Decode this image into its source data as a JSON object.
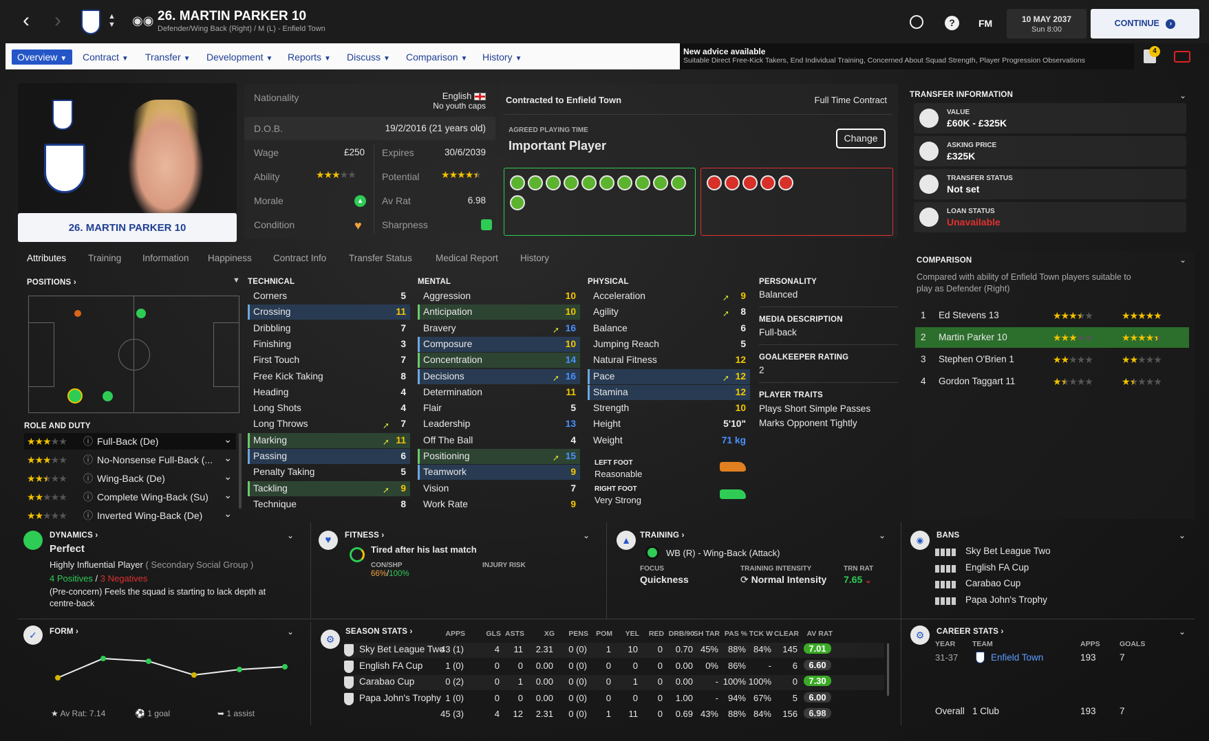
{
  "header": {
    "title": "26. MARTIN PARKER 10",
    "subtitle": "Defender/Wing Back (Right) / M (L) - Enfield Town",
    "date": "10 MAY 2037",
    "time": "Sun 8:00",
    "continue_label": "CONTINUE",
    "fm_label": "FM",
    "news_badge": "4"
  },
  "menu": [
    {
      "label": "Overview"
    },
    {
      "label": "Contract"
    },
    {
      "label": "Transfer"
    },
    {
      "label": "Development"
    },
    {
      "label": "Reports"
    },
    {
      "label": "Discuss"
    },
    {
      "label": "Comparison"
    },
    {
      "label": "History"
    }
  ],
  "advice": {
    "title": "New advice available",
    "text": "Suitable Direct Free-Kick Takers, End Individual Training, Concerned About Squad Strength, Player Progression Observations"
  },
  "player_card": {
    "name": "26. MARTIN PARKER 10"
  },
  "info": {
    "nationality_label": "Nationality",
    "nationality": "English",
    "youth_caps": "No youth caps",
    "dob_label": "D.O.B.",
    "dob": "19/2/2016 (21 years old)",
    "wage_label": "Wage",
    "wage": "£250",
    "expires_label": "Expires",
    "expires": "30/6/2039",
    "ability_label": "Ability",
    "potential_label": "Potential",
    "morale_label": "Morale",
    "avrat_label": "Av Rat",
    "avrat": "6.98",
    "condition_label": "Condition",
    "sharpness_label": "Sharpness"
  },
  "contract": {
    "title": "Contracted to Enfield Town",
    "type": "Full Time Contract",
    "playing_time_label": "AGREED PLAYING TIME",
    "playing_time": "Important Player",
    "change_label": "Change"
  },
  "tabs": [
    "Attributes",
    "Training",
    "Information",
    "Happiness",
    "Contract Info",
    "Transfer Status",
    "Medical Report",
    "History"
  ],
  "positions_label": "POSITIONS",
  "role_duty_label": "ROLE AND DUTY",
  "roles": [
    {
      "label": "Full-Back (De)",
      "stars": 3
    },
    {
      "label": "No-Nonsense Full-Back (...",
      "stars": 3
    },
    {
      "label": "Wing-Back (De)",
      "stars": 2.5
    },
    {
      "label": "Complete Wing-Back (Su)",
      "stars": 2
    },
    {
      "label": "Inverted Wing-Back (De)",
      "stars": 2
    }
  ],
  "technical": {
    "title": "TECHNICAL",
    "items": [
      {
        "name": "Corners",
        "value": "5"
      },
      {
        "name": "Crossing",
        "value": "11"
      },
      {
        "name": "Dribbling",
        "value": "7"
      },
      {
        "name": "Finishing",
        "value": "3"
      },
      {
        "name": "First Touch",
        "value": "7"
      },
      {
        "name": "Free Kick Taking",
        "value": "8"
      },
      {
        "name": "Heading",
        "value": "4"
      },
      {
        "name": "Long Shots",
        "value": "4"
      },
      {
        "name": "Long Throws",
        "value": "7"
      },
      {
        "name": "Marking",
        "value": "11"
      },
      {
        "name": "Passing",
        "value": "6"
      },
      {
        "name": "Penalty Taking",
        "value": "5"
      },
      {
        "name": "Tackling",
        "value": "9"
      },
      {
        "name": "Technique",
        "value": "8"
      }
    ]
  },
  "mental": {
    "title": "MENTAL",
    "items": [
      {
        "name": "Aggression",
        "value": "10"
      },
      {
        "name": "Anticipation",
        "value": "10"
      },
      {
        "name": "Bravery",
        "value": "16"
      },
      {
        "name": "Composure",
        "value": "10"
      },
      {
        "name": "Concentration",
        "value": "14"
      },
      {
        "name": "Decisions",
        "value": "16"
      },
      {
        "name": "Determination",
        "value": "11"
      },
      {
        "name": "Flair",
        "value": "5"
      },
      {
        "name": "Leadership",
        "value": "13"
      },
      {
        "name": "Off The Ball",
        "value": "4"
      },
      {
        "name": "Positioning",
        "value": "15"
      },
      {
        "name": "Teamwork",
        "value": "9"
      },
      {
        "name": "Vision",
        "value": "7"
      },
      {
        "name": "Work Rate",
        "value": "9"
      }
    ]
  },
  "physical": {
    "title": "PHYSICAL",
    "items": [
      {
        "name": "Acceleration",
        "value": "9"
      },
      {
        "name": "Agility",
        "value": "8"
      },
      {
        "name": "Balance",
        "value": "6"
      },
      {
        "name": "Jumping Reach",
        "value": "5"
      },
      {
        "name": "Natural Fitness",
        "value": "12"
      },
      {
        "name": "Pace",
        "value": "12"
      },
      {
        "name": "Stamina",
        "value": "12"
      },
      {
        "name": "Strength",
        "value": "10"
      },
      {
        "name": "Height",
        "value": "5'10\""
      },
      {
        "name": "Weight",
        "value": "71 kg"
      }
    ]
  },
  "feet": {
    "left_label": "LEFT FOOT",
    "left": "Reasonable",
    "right_label": "RIGHT FOOT",
    "right": "Very Strong"
  },
  "personality": {
    "label": "PERSONALITY",
    "value": "Balanced",
    "media_label": "MEDIA DESCRIPTION",
    "media": "Full-back",
    "gk_label": "GOALKEEPER RATING",
    "gk": "2",
    "traits_label": "PLAYER TRAITS",
    "traits": [
      "Plays Short Simple Passes",
      "Marks Opponent Tightly"
    ]
  },
  "transfer": {
    "title": "TRANSFER INFORMATION",
    "value_label": "VALUE",
    "value": "£60K - £325K",
    "asking_label": "ASKING PRICE",
    "asking": "£325K",
    "status_label": "TRANSFER STATUS",
    "status": "Not set",
    "loan_label": "LOAN STATUS",
    "loan": "Unavailable"
  },
  "comparison": {
    "title": "COMPARISON",
    "desc": "Compared with ability of Enfield Town players suitable to play as Defender (Right)",
    "rows": [
      {
        "rank": "1",
        "name": "Ed Stevens 13",
        "ca": 3.5,
        "pa": 5
      },
      {
        "rank": "2",
        "name": "Martin Parker 10",
        "ca": 3,
        "pa": 4.5
      },
      {
        "rank": "3",
        "name": "Stephen O'Brien 1",
        "ca": 2,
        "pa": 2
      },
      {
        "rank": "4",
        "name": "Gordon Taggart 11",
        "ca": 1.5,
        "pa": 1.5
      }
    ]
  },
  "dynamics": {
    "title": "DYNAMICS",
    "value": "Perfect",
    "influence": "Highly Influential Player",
    "group": "( Secondary Social Group )",
    "positives": "4 Positives",
    "sep": "/",
    "negatives": "3 Negatives",
    "concern": "(Pre-concern) Feels the squad is starting to lack depth at centre-back"
  },
  "fitness": {
    "title": "FITNESS",
    "status": "Tired after his last match",
    "conshp_label": "CON/SHP",
    "con": "66%",
    "slash": "/",
    "shp": "100%",
    "injury_label": "INJURY RISK"
  },
  "training": {
    "title": "TRAINING",
    "role": "WB (R) - Wing-Back (Attack)",
    "focus_label": "FOCUS",
    "focus": "Quickness",
    "intensity_label": "TRAINING INTENSITY",
    "intensity": "Normal Intensity",
    "trnrat_label": "TRN RAT",
    "trnrat": "7.65"
  },
  "bans": {
    "title": "BANS",
    "items": [
      "Sky Bet League Two",
      "English FA Cup",
      "Carabao Cup",
      "Papa John's Trophy"
    ]
  },
  "form": {
    "title": "FORM",
    "avrat": "Av Rat: 7.14",
    "goals": "1 goal",
    "assists": "1 assist",
    "points": [
      6.8,
      7.5,
      7.4,
      6.9,
      7.1,
      7.2
    ]
  },
  "season": {
    "title": "SEASON STATS",
    "headers": [
      "APPS",
      "GLS",
      "ASTS",
      "XG",
      "PENS",
      "POM",
      "YEL",
      "RED",
      "DRB/90",
      "SH TAR",
      "PAS %",
      "TCK W",
      "CLEAR",
      "AV RAT"
    ],
    "rows": [
      {
        "comp": "Sky Bet League Two",
        "vals": [
          "43 (1)",
          "4",
          "11",
          "2.31",
          "0 (0)",
          "1",
          "10",
          "0",
          "0.70",
          "45%",
          "88%",
          "84%",
          "145",
          "7.01"
        ],
        "rating": "good"
      },
      {
        "comp": "English FA Cup",
        "vals": [
          "1 (0)",
          "0",
          "0",
          "0.00",
          "0 (0)",
          "0",
          "0",
          "0",
          "0.00",
          "0%",
          "86%",
          "-",
          "6",
          "6.60"
        ],
        "rating": "mid"
      },
      {
        "comp": "Carabao Cup",
        "vals": [
          "0 (2)",
          "0",
          "1",
          "0.00",
          "0 (0)",
          "0",
          "1",
          "0",
          "0.00",
          "-",
          "100%",
          "100%",
          "0",
          "7.30"
        ],
        "rating": "good"
      },
      {
        "comp": "Papa John's Trophy",
        "vals": [
          "1 (0)",
          "0",
          "0",
          "0.00",
          "0 (0)",
          "0",
          "0",
          "0",
          "1.00",
          "-",
          "94%",
          "67%",
          "5",
          "6.00"
        ],
        "rating": "mid"
      }
    ],
    "total": [
      "45 (3)",
      "4",
      "12",
      "2.31",
      "0 (0)",
      "1",
      "11",
      "0",
      "0.69",
      "43%",
      "88%",
      "84%",
      "156",
      "6.98"
    ]
  },
  "career": {
    "title": "CAREER STATS",
    "year_label": "YEAR",
    "team_label": "TEAM",
    "apps_label": "APPS",
    "goals_label": "GOALS",
    "year": "31-37",
    "team": "Enfield Town",
    "apps": "193",
    "goals": "7",
    "overall": "Overall",
    "clubs": "1 Club",
    "total_apps": "193",
    "total_goals": "7"
  },
  "colors": {
    "accent": "#2456c7",
    "gold": "#f2c200",
    "green": "#2ecc55",
    "red": "#e03030"
  }
}
